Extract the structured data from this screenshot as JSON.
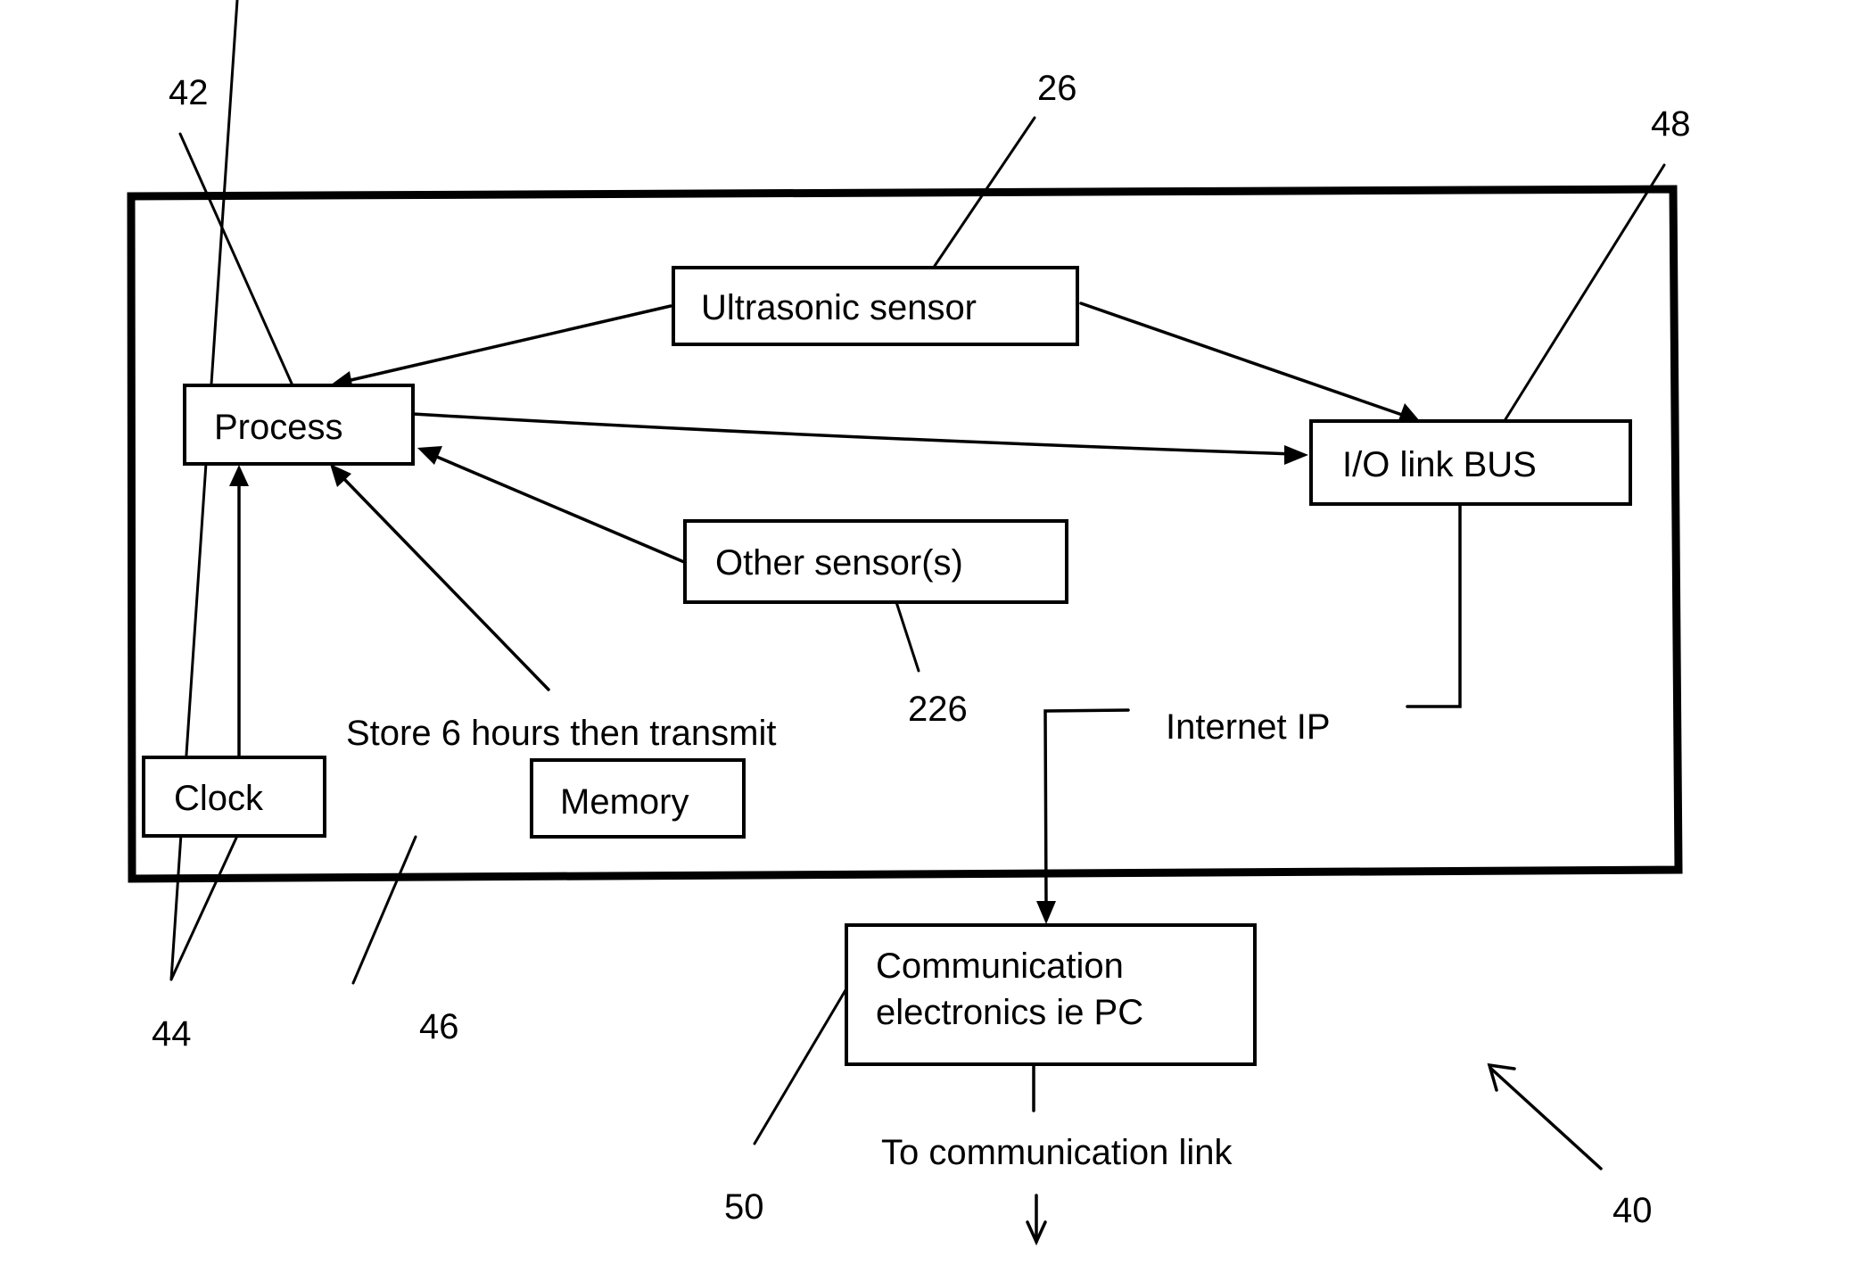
{
  "figure": {
    "reference_number": "40",
    "components": {
      "ultrasonic_sensor": {
        "label": "Ultrasonic sensor",
        "ref": "26"
      },
      "process": {
        "label": "Process",
        "ref": "42"
      },
      "io_link_bus": {
        "label": "I/O link BUS",
        "ref": "48"
      },
      "other_sensors": {
        "label": "Other sensor(s)",
        "ref": "226"
      },
      "clock": {
        "label": "Clock",
        "ref": "44"
      },
      "memory": {
        "label": "Memory",
        "ref": "46"
      },
      "communication": {
        "label_line1": "Communication",
        "label_line2": "electronics ie PC",
        "ref": "50"
      }
    },
    "annotations": {
      "store": "Store 6 hours then transmit",
      "internet": "Internet IP",
      "to_link": "To communication link"
    },
    "connections": [
      {
        "from": "Ultrasonic sensor",
        "to": "Process",
        "arrow": true
      },
      {
        "from": "Ultrasonic sensor",
        "to": "I/O link BUS",
        "arrow": true
      },
      {
        "from": "Process",
        "to": "I/O link BUS",
        "arrow": true
      },
      {
        "from": "Other sensor(s)",
        "to": "Process",
        "arrow": true
      },
      {
        "from": "Clock",
        "to": "Process",
        "arrow": true
      },
      {
        "from": "Memory",
        "to": "Process",
        "arrow": true,
        "label": "Store 6 hours then transmit"
      },
      {
        "from": "I/O link BUS",
        "to": "Communication electronics ie PC",
        "arrow": true,
        "label": "Internet IP"
      },
      {
        "from": "Communication electronics ie PC",
        "to": "communication link",
        "arrow": true,
        "label": "To communication link"
      }
    ]
  }
}
